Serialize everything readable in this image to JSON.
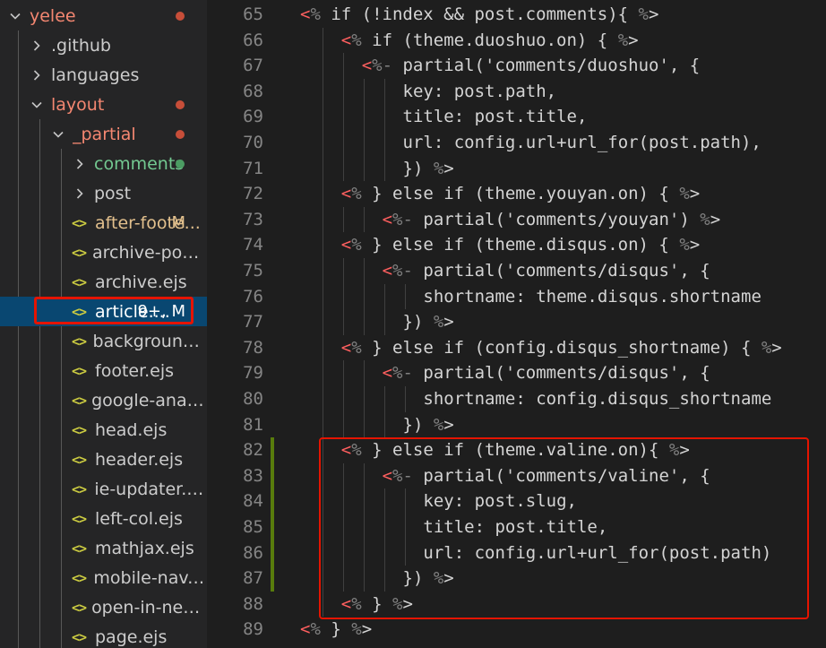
{
  "explorer": {
    "items": [
      {
        "label": "yelee",
        "kind": "folder",
        "expanded": true,
        "indent": 0,
        "color": "#f48771",
        "dot": "#c74e39"
      },
      {
        "label": ".github",
        "kind": "folder",
        "expanded": false,
        "indent": 1,
        "color": "#cccccc"
      },
      {
        "label": "languages",
        "kind": "folder",
        "expanded": false,
        "indent": 1,
        "color": "#cccccc"
      },
      {
        "label": "layout",
        "kind": "folder",
        "expanded": true,
        "indent": 1,
        "color": "#f48771",
        "dot": "#c74e39"
      },
      {
        "label": "_partial",
        "kind": "folder",
        "expanded": true,
        "indent": 2,
        "color": "#f48771",
        "dot": "#c74e39"
      },
      {
        "label": "comments",
        "kind": "folder",
        "expanded": false,
        "indent": 3,
        "color": "#73c991",
        "dot": "#4b9c62"
      },
      {
        "label": "post",
        "kind": "folder",
        "expanded": false,
        "indent": 3,
        "color": "#cccccc"
      },
      {
        "label": "after-foote...",
        "kind": "file",
        "indent": 3,
        "color": "#e2c08d",
        "badge": "M",
        "badge_color": "#e2c08d"
      },
      {
        "label": "archive-post.ejs",
        "kind": "file",
        "indent": 3,
        "color": "#cccccc"
      },
      {
        "label": "archive.ejs",
        "kind": "file",
        "indent": 3,
        "color": "#cccccc"
      },
      {
        "label": "article....",
        "kind": "file",
        "indent": 3,
        "color": "#ffffff",
        "badge": "9+, M",
        "badge_color": "#ffffff",
        "active": true
      },
      {
        "label": "background.ejs",
        "kind": "file",
        "indent": 3,
        "color": "#cccccc"
      },
      {
        "label": "footer.ejs",
        "kind": "file",
        "indent": 3,
        "color": "#cccccc"
      },
      {
        "label": "google-analytic...",
        "kind": "file",
        "indent": 3,
        "color": "#cccccc"
      },
      {
        "label": "head.ejs",
        "kind": "file",
        "indent": 3,
        "color": "#cccccc"
      },
      {
        "label": "header.ejs",
        "kind": "file",
        "indent": 3,
        "color": "#cccccc"
      },
      {
        "label": "ie-updater.ejs",
        "kind": "file",
        "indent": 3,
        "color": "#cccccc"
      },
      {
        "label": "left-col.ejs",
        "kind": "file",
        "indent": 3,
        "color": "#cccccc"
      },
      {
        "label": "mathjax.ejs",
        "kind": "file",
        "indent": 3,
        "color": "#cccccc"
      },
      {
        "label": "mobile-nav.ejs",
        "kind": "file",
        "indent": 3,
        "color": "#cccccc"
      },
      {
        "label": "open-in-new-ta...",
        "kind": "file",
        "indent": 3,
        "color": "#cccccc"
      },
      {
        "label": "page.ejs",
        "kind": "file",
        "indent": 3,
        "color": "#cccccc"
      }
    ],
    "file_icon": "<>"
  },
  "editor": {
    "lines": [
      {
        "n": "65",
        "indent": 0,
        "tokens": [
          [
            "tag",
            "<"
          ],
          [
            "p",
            "%"
          ],
          [
            "t",
            " if (!index && post.comments){ "
          ],
          [
            "p",
            "%"
          ],
          [
            "t",
            ">"
          ]
        ]
      },
      {
        "n": "66",
        "indent": 2,
        "tokens": [
          [
            "tag",
            "<"
          ],
          [
            "p",
            "%"
          ],
          [
            "t",
            " if (theme.duoshuo.on) { "
          ],
          [
            "p",
            "%"
          ],
          [
            "t",
            ">"
          ]
        ]
      },
      {
        "n": "67",
        "indent": 3,
        "tokens": [
          [
            "tag",
            "<"
          ],
          [
            "p",
            "%-"
          ],
          [
            "t",
            " partial('comments/duoshuo', {"
          ]
        ]
      },
      {
        "n": "68",
        "indent": 5,
        "tokens": [
          [
            "t",
            "key: post.path,"
          ]
        ]
      },
      {
        "n": "69",
        "indent": 5,
        "tokens": [
          [
            "t",
            "title: post.title,"
          ]
        ]
      },
      {
        "n": "70",
        "indent": 5,
        "tokens": [
          [
            "t",
            "url: config.url+url_for(post.path),"
          ]
        ]
      },
      {
        "n": "71",
        "indent": 5,
        "tokens": [
          [
            "t",
            "}) "
          ],
          [
            "p",
            "%"
          ],
          [
            "t",
            ">"
          ]
        ]
      },
      {
        "n": "72",
        "indent": 2,
        "tokens": [
          [
            "tag",
            "<"
          ],
          [
            "p",
            "%"
          ],
          [
            "t",
            " } else if (theme.youyan.on) { "
          ],
          [
            "p",
            "%"
          ],
          [
            "t",
            ">"
          ]
        ]
      },
      {
        "n": "73",
        "indent": 4,
        "tokens": [
          [
            "tag",
            "<"
          ],
          [
            "p",
            "%-"
          ],
          [
            "t",
            " partial('comments/youyan') "
          ],
          [
            "p",
            "%"
          ],
          [
            "t",
            ">"
          ]
        ]
      },
      {
        "n": "74",
        "indent": 2,
        "tokens": [
          [
            "tag",
            "<"
          ],
          [
            "p",
            "%"
          ],
          [
            "t",
            " } else if (theme.disqus.on) { "
          ],
          [
            "p",
            "%"
          ],
          [
            "t",
            ">"
          ]
        ]
      },
      {
        "n": "75",
        "indent": 4,
        "tokens": [
          [
            "tag",
            "<"
          ],
          [
            "p",
            "%-"
          ],
          [
            "t",
            " partial('comments/disqus', {"
          ]
        ]
      },
      {
        "n": "76",
        "indent": 6,
        "tokens": [
          [
            "t",
            "shortname: theme.disqus.shortname"
          ]
        ]
      },
      {
        "n": "77",
        "indent": 5,
        "tokens": [
          [
            "t",
            "}) "
          ],
          [
            "p",
            "%"
          ],
          [
            "t",
            ">"
          ]
        ]
      },
      {
        "n": "78",
        "indent": 2,
        "tokens": [
          [
            "tag",
            "<"
          ],
          [
            "p",
            "%"
          ],
          [
            "t",
            " } else if (config.disqus_shortname) { "
          ],
          [
            "p",
            "%"
          ],
          [
            "t",
            ">"
          ]
        ]
      },
      {
        "n": "79",
        "indent": 4,
        "tokens": [
          [
            "tag",
            "<"
          ],
          [
            "p",
            "%-"
          ],
          [
            "t",
            " partial('comments/disqus', {"
          ]
        ]
      },
      {
        "n": "80",
        "indent": 6,
        "tokens": [
          [
            "t",
            "shortname: config.disqus_shortname"
          ]
        ]
      },
      {
        "n": "81",
        "indent": 5,
        "tokens": [
          [
            "t",
            "}) "
          ],
          [
            "p",
            "%"
          ],
          [
            "t",
            ">"
          ]
        ]
      },
      {
        "n": "82",
        "indent": 2,
        "mod": true,
        "tokens": [
          [
            "tag",
            "<"
          ],
          [
            "p",
            "%"
          ],
          [
            "t",
            " } else if (theme.valine.on){ "
          ],
          [
            "p",
            "%"
          ],
          [
            "t",
            ">"
          ]
        ]
      },
      {
        "n": "83",
        "indent": 4,
        "mod": true,
        "tokens": [
          [
            "tag",
            "<"
          ],
          [
            "p",
            "%-"
          ],
          [
            "t",
            " partial('comments/valine', {"
          ]
        ]
      },
      {
        "n": "84",
        "indent": 6,
        "mod": true,
        "tokens": [
          [
            "t",
            "key: post.slug,"
          ]
        ]
      },
      {
        "n": "85",
        "indent": 6,
        "mod": true,
        "tokens": [
          [
            "t",
            "title: post.title,"
          ]
        ]
      },
      {
        "n": "86",
        "indent": 6,
        "mod": true,
        "tokens": [
          [
            "t",
            "url: config.url+url_for(post.path)"
          ]
        ]
      },
      {
        "n": "87",
        "indent": 5,
        "mod": true,
        "tokens": [
          [
            "t",
            "}) "
          ],
          [
            "p",
            "%"
          ],
          [
            "t",
            ">"
          ]
        ]
      },
      {
        "n": "88",
        "indent": 2,
        "tokens": [
          [
            "tag",
            "<"
          ],
          [
            "p",
            "%"
          ],
          [
            "t",
            " } "
          ],
          [
            "p",
            "%"
          ],
          [
            "t",
            ">"
          ]
        ]
      },
      {
        "n": "89",
        "indent": 0,
        "tokens": [
          [
            "tag",
            "<"
          ],
          [
            "p",
            "%"
          ],
          [
            "t",
            " } "
          ],
          [
            "p",
            "%"
          ],
          [
            "t",
            ">"
          ]
        ]
      }
    ]
  },
  "colors": {
    "accent_red": "#e51400",
    "modified_gutter": "#587c0c",
    "active_row": "#094771"
  }
}
